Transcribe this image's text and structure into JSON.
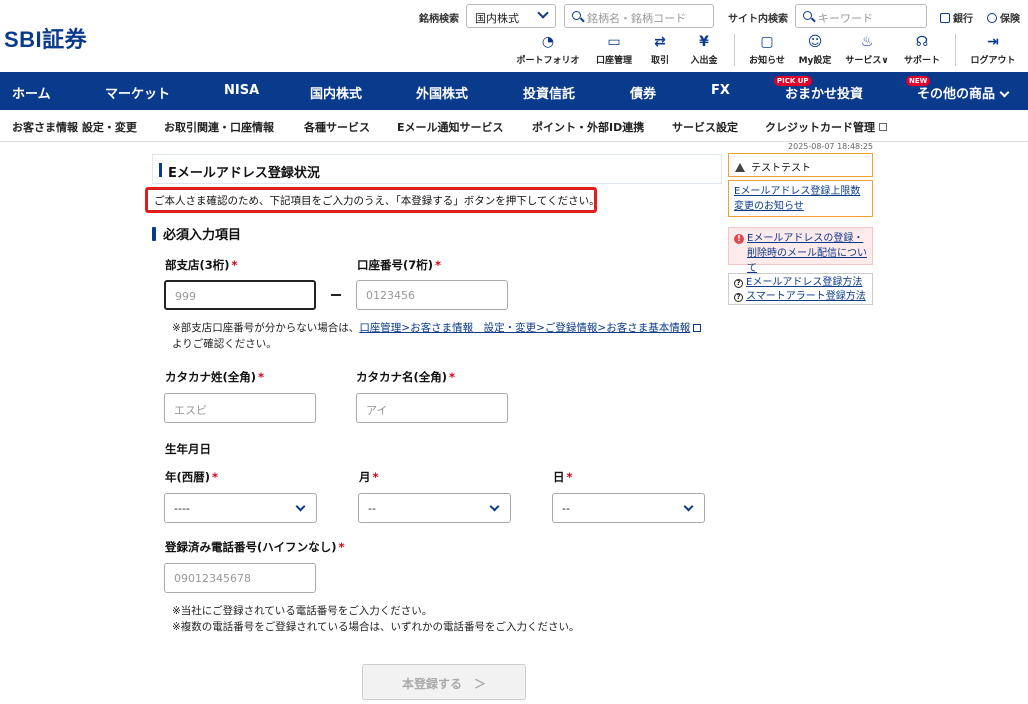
{
  "header": {
    "logo_text": "SBI証券",
    "stock_search_label": "銘柄検索",
    "market_select": "国内株式",
    "stock_search_placeholder": "銘柄名・銘柄コード",
    "site_search_label": "サイト内検索",
    "site_search_placeholder": "キーワード",
    "bank_link": "銀行",
    "insurance_link": "保険",
    "icons": [
      {
        "label": "ポートフォリオ",
        "icon": "portfolio-icon"
      },
      {
        "label": "口座管理",
        "icon": "account-icon"
      },
      {
        "label": "取引",
        "icon": "trade-icon"
      },
      {
        "label": "入出金",
        "icon": "deposit-icon"
      },
      {
        "label": "お知らせ",
        "icon": "notice-icon"
      },
      {
        "label": "My設定",
        "icon": "my-settings-icon"
      },
      {
        "label": "サービス",
        "icon": "services-icon"
      },
      {
        "label": "サポート",
        "icon": "support-icon"
      },
      {
        "label": "ログアウト",
        "icon": "logout-icon"
      }
    ]
  },
  "mainnav": {
    "items": [
      "ホーム",
      "マーケット",
      "NISA",
      "国内株式",
      "外国株式",
      "投資信託",
      "債券",
      "FX",
      "おまかせ投資",
      "その他の商品"
    ],
    "badge_pickup": "PICK UP",
    "badge_new": "NEW"
  },
  "subnav": {
    "items": [
      "お客さま情報 設定・変更",
      "お取引関連・口座情報",
      "各種サービス",
      "Eメール通知サービス",
      "ポイント・外部ID連携",
      "サービス設定",
      "クレジットカード管理"
    ]
  },
  "timestamp": "2025-08-07 18:48:25",
  "main": {
    "title": "Eメールアドレス登録状況",
    "notice": "ご本人さま確認のため、下記項目をご入力のうえ、「本登録する」ボタンを押下してください。",
    "section_title": "必須入力項目",
    "required_mark": "*",
    "branch_label": "部支店(3桁)",
    "branch_placeholder": "999",
    "account_label": "口座番号(7桁)",
    "account_placeholder": "0123456",
    "help_prefix": "※部支店口座番号が分からない場合は、",
    "help_link": "口座管理>お客さま情報　設定・変更>ご登録情報>お客さま基本情報",
    "help_suffix": "よりご確認ください。",
    "kana_last_label": "カタカナ姓(全角)",
    "kana_last_placeholder": "エスビ",
    "kana_first_label": "カタカナ名(全角)",
    "kana_first_placeholder": "アイ",
    "dob_label": "生年月日",
    "year_label": "年(西暦)",
    "year_value": "----",
    "month_label": "月",
    "month_value": "--",
    "day_label": "日",
    "day_value": "--",
    "phone_label": "登録済み電話番号(ハイフンなし)",
    "phone_placeholder": "09012345678",
    "phone_note1": "※当社にご登録されている電話番号をご入力ください。",
    "phone_note2": "※複数の電話番号をご登録されている場合は、いずれかの電話番号をご入力ください。",
    "submit_label": "本登録する　＞"
  },
  "sidebar": {
    "notice": "テストテスト",
    "link1": "Eメールアドレス登録上限数変更のお知らせ",
    "link2": "Eメールアドレスの登録・削除時のメール配信について",
    "link3a": "Eメールアドレス登録方法",
    "link3b": "スマートアラート登録方法"
  },
  "colors": {
    "brand": "#0a3a8c",
    "alert": "#e01e1e",
    "required": "#d6001c"
  }
}
